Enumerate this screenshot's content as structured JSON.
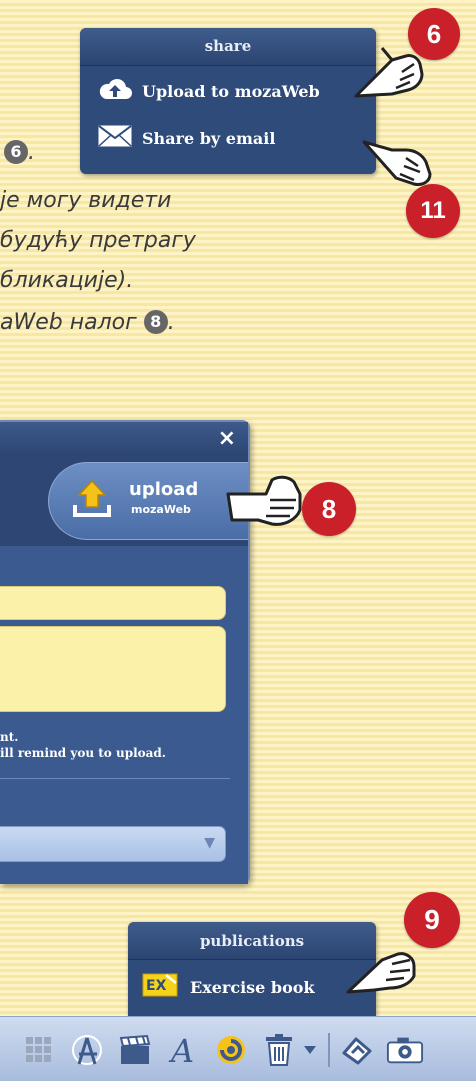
{
  "share_menu": {
    "title": "share",
    "items": [
      {
        "label": "Upload to mozaWeb",
        "icon": "cloud-upload-icon"
      },
      {
        "label": "Share by email",
        "icon": "envelope-icon"
      }
    ]
  },
  "badges": {
    "six": "6",
    "eleven": "11",
    "eight": "8",
    "nine": "9"
  },
  "text_lines": [
    "6",
    "је могу видети",
    "будућу претрагу",
    "бликације).",
    "aWeb налог",
    "8"
  ],
  "dialog": {
    "close": "×",
    "upload_title": "upload",
    "upload_sub": "mozaWeb",
    "note_line1": "nt.",
    "note_line2": "ill remind you to upload.",
    "select_arrow": "▼"
  },
  "pubs_menu": {
    "title": "publications",
    "item_label": "Exercise book"
  },
  "toolbar": {
    "icons": [
      "grid-icon",
      "compass-icon",
      "clapperboard-icon",
      "text-icon",
      "spotlight-icon",
      "trash-icon",
      "dropdown-arrow-icon",
      "highlight-icon",
      "camera-icon"
    ]
  },
  "colors": {
    "badge": "#c9202a",
    "menu": "#2f4b79",
    "field": "#fbf1a8"
  }
}
